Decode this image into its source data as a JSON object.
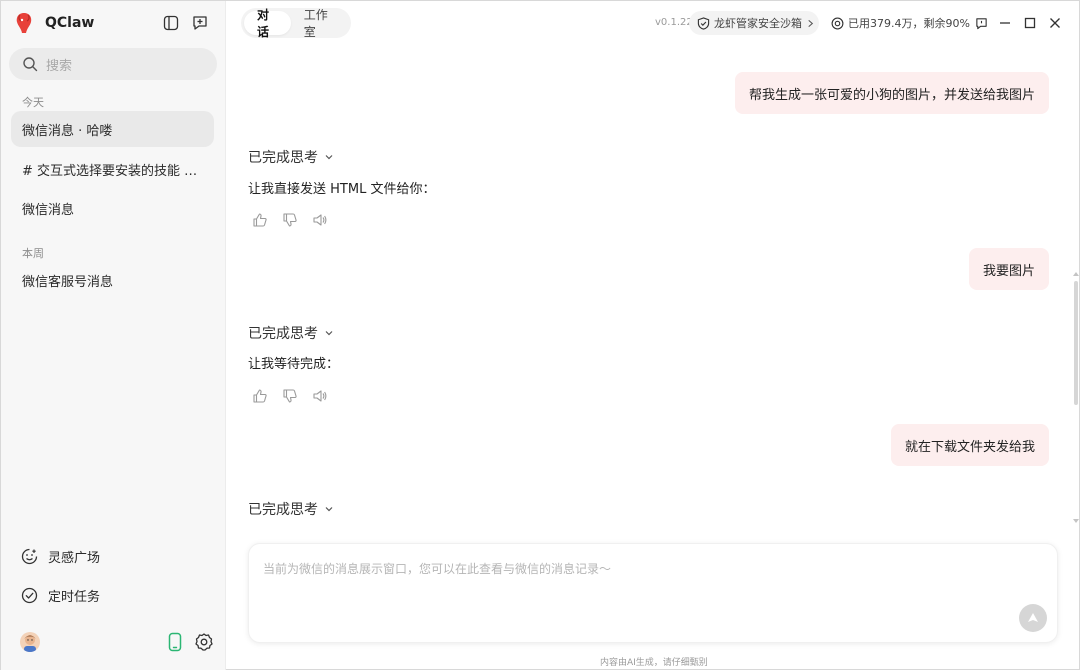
{
  "app": {
    "name": "QClaw"
  },
  "sidebar": {
    "search_placeholder": "搜索",
    "sections": [
      {
        "label": "今天"
      },
      {
        "label": "本周"
      }
    ],
    "items": [
      {
        "label": "微信消息 · 哈喽"
      },
      {
        "label": "# 交互式选择要安装的技能 npx skills add"
      },
      {
        "label": "微信消息"
      },
      {
        "label": "微信客服号消息"
      }
    ],
    "bottom": [
      {
        "label": "灵感广场",
        "icon": "smile-icon"
      },
      {
        "label": "定时任务",
        "icon": "clock-check-icon"
      }
    ]
  },
  "topbar": {
    "tabs": [
      {
        "label": "对话"
      },
      {
        "label": "工作室"
      }
    ],
    "version": "v0.1.22",
    "sandbox_label": "龙虾管家安全沙箱",
    "usage_label": "已用379.4万，剩余90%"
  },
  "chat": {
    "messages": [
      {
        "role": "user",
        "text": "帮我生成一张可爱的小狗的图片，并发送给我图片"
      },
      {
        "role": "assistant",
        "think": "已完成思考",
        "text": "让我直接发送 HTML 文件给你："
      },
      {
        "role": "user",
        "text": "我要图片"
      },
      {
        "role": "assistant",
        "think": "已完成思考",
        "text": "让我等待完成："
      },
      {
        "role": "user",
        "text": "就在下载文件夹发给我"
      },
      {
        "role": "assistant",
        "think": "已完成思考"
      }
    ]
  },
  "composer": {
    "placeholder": "当前为微信的消息展示窗口，您可以在此查看与微信的消息记录～"
  },
  "footer": {
    "note": "内容由AI生成，请仔细甄别"
  },
  "colors": {
    "user_bubble": "#fdeeee",
    "sidebar_bg": "#f7f7f7",
    "accent_green": "#2bb673"
  }
}
